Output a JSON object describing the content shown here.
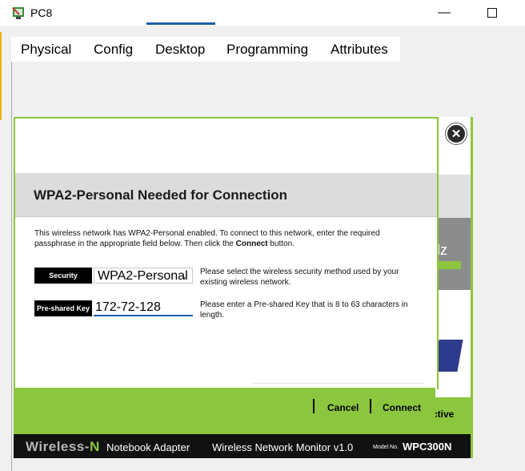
{
  "window": {
    "title": "PC8"
  },
  "tabs": [
    {
      "label": "Physical"
    },
    {
      "label": "Config"
    },
    {
      "label": "Desktop",
      "active": true
    },
    {
      "label": "Programming"
    },
    {
      "label": "Attributes"
    }
  ],
  "background_app": {
    "partial_text_1": "lz",
    "partial_text_2": "ctive"
  },
  "dialog": {
    "title": "WPA2-Personal Needed for Connection",
    "description_1": "This wireless network has WPA2-Personal enabled. To connect to this network, enter the required passphrase in the appropriate field below. Then click the ",
    "description_bold": "Connect",
    "description_2": " button.",
    "security_label": "Security",
    "security_value": "WPA2-Personal",
    "security_help": "Please select the wireless security method used by your existing wireless network.",
    "key_label": "Pre-shared Key",
    "key_value": "172-72-128",
    "key_help": "Please enter a Pre-shared Key that is 8 to 63 characters in length.",
    "cancel_label": "Cancel",
    "connect_label": "Connect"
  },
  "brand": {
    "wireless": "Wireless-",
    "n": "N",
    "subtitle": "Notebook Adapter",
    "monitor": "Wireless Network Monitor  v1.0",
    "model_label": "Model No.",
    "model": "WPC300N"
  },
  "colors": {
    "accent_green": "#8cc63e",
    "tab_underline": "#1c5fa8"
  }
}
